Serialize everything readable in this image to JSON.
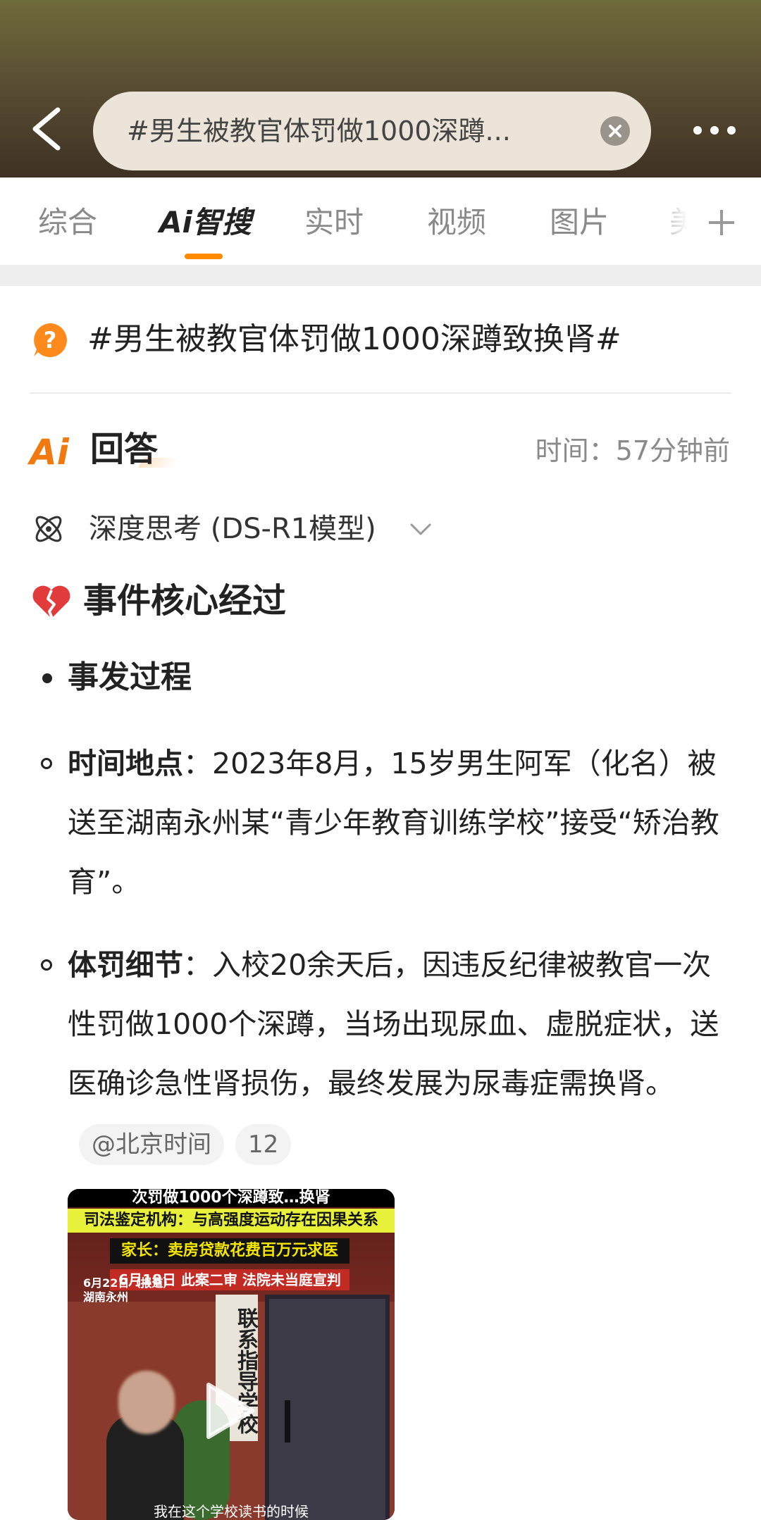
{
  "header": {
    "search_text": "#男生被教官体罚做1000深蹲...",
    "icons": {
      "back": "chevron-left-icon",
      "clear": "clear-circle-icon",
      "more": "more-dots-icon"
    }
  },
  "tabs": [
    {
      "label": "综合"
    },
    {
      "label": "Ai智搜",
      "active": true
    },
    {
      "label": "实时"
    },
    {
      "label": "视频"
    },
    {
      "label": "图片"
    },
    {
      "label": "美"
    }
  ],
  "question": {
    "title": "#男生被教官体罚做1000深蹲致换肾#"
  },
  "answer": {
    "ai_logo": "Ai",
    "label": "回答",
    "time": "时间：57分钟前",
    "think_mode": "深度思考 (DS-R1模型)"
  },
  "content": {
    "section_title": "事件核心经过",
    "sub_heading": "事发过程",
    "items": [
      {
        "key": "时间地点",
        "text": "：2023年8月，15岁男生阿军（化名）被送至湖南永州某“青少年教育训练学校”接受“矫治教育”。"
      },
      {
        "key": "体罚细节",
        "text": "：入校20余天后，因违反纪律被教官一次性罚做1000个深蹲，当场出现尿血、虚脱症状，送医确诊急性肾损伤，最终发展为尿毒症需换肾。",
        "source_chip": "@北京时间",
        "count_chip": "12"
      }
    ]
  },
  "video": {
    "banner1": "次罚做1000个深蹲致…换肾",
    "banner2": "司法鉴定机构：与高强度运动存在因果关系",
    "banner3": "家长：卖房贷款花费百万元求医",
    "banner4": "6月18日 此案二审 法院未当庭宣判",
    "date_line1": "6月22日（报道）",
    "date_line2": "湖南永州",
    "sign": "联系指导学校",
    "caption": "我在这个学校读书的时候"
  },
  "colors": {
    "accent": "#ff8a00",
    "header_top": "#6f6a3a",
    "header_bottom": "#3f3124"
  }
}
